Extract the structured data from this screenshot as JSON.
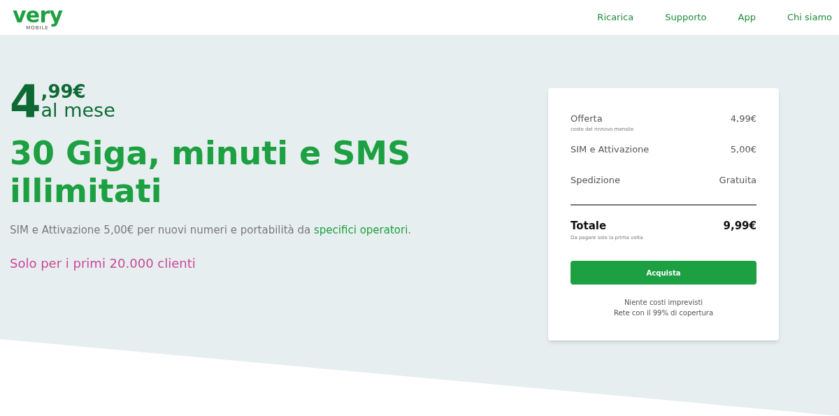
{
  "header": {
    "logo": "very",
    "logo_sub": "MOBILE",
    "nav": [
      "Ricarica",
      "Supporto",
      "App",
      "Chi siamo"
    ]
  },
  "hero": {
    "price_int": "4",
    "price_dec": ",99€",
    "price_period": "al mese",
    "headline": "30 Giga, minuti e SMS illimitati",
    "note": {
      "before": "SIM e Attivazione 5,00€ per nuovi numeri e portabilità da ",
      "link": "specifici operatori",
      "after": "."
    },
    "promo": "Solo per i primi 20.000 clienti"
  },
  "summary": {
    "rows": [
      {
        "label": "Offerta",
        "sub": "costo del rinnovo mensile",
        "value": "4,99€"
      },
      {
        "label": "SIM e Attivazione",
        "value": "5,00€"
      },
      {
        "label": "Spedizione",
        "value": "Gratuita"
      }
    ],
    "total": {
      "label": "Totale",
      "sub": "Da pagare solo la prima volta",
      "value": "9,99€"
    },
    "button": "Acquista",
    "footer": [
      "Niente costi imprevisti",
      "Rete con il 99% di copertura"
    ]
  }
}
